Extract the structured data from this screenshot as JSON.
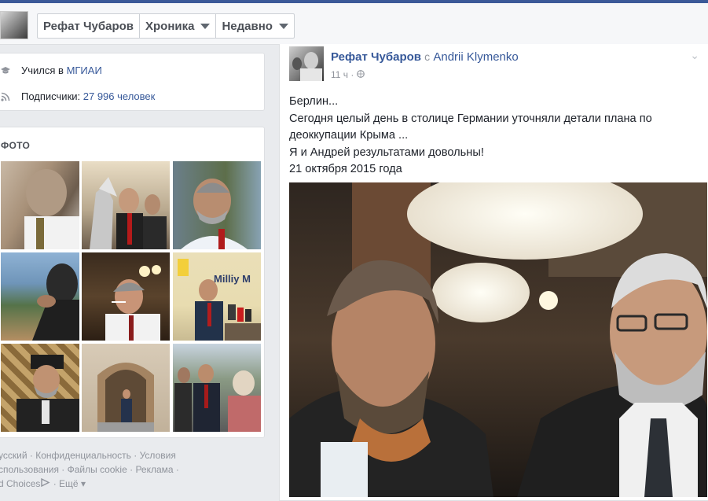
{
  "header": {
    "profile_name": "Рефат Чубаров",
    "timeline_label": "Хроника",
    "recent_label": "Недавно"
  },
  "about": {
    "studied_prefix": "Учился в",
    "studied_school": "МГИАИ",
    "followers_prefix": "Подписчики:",
    "followers_count": "27 996 человек"
  },
  "photos": {
    "title": "ФОТО"
  },
  "footer": {
    "links": [
      "усский",
      "Конфиденциальность",
      "Условия",
      "спользования",
      "Файлы cookie",
      "Реклама",
      "d Choices",
      "Ещё"
    ]
  },
  "post": {
    "author": "Рефат Чубаров",
    "with_word": "с",
    "with_name": "Andrii Klymenko",
    "time": "11 ч",
    "lines": [
      "Берлин...",
      "Сегодня целый день в столице Германии уточняли детали плана по",
      "деоккупации Крыма ...",
      "Я и Андрей результатами довольны!",
      "21 октября 2015 года"
    ]
  },
  "colors": {
    "facebook_blue": "#3b5998",
    "link": "#365899"
  }
}
